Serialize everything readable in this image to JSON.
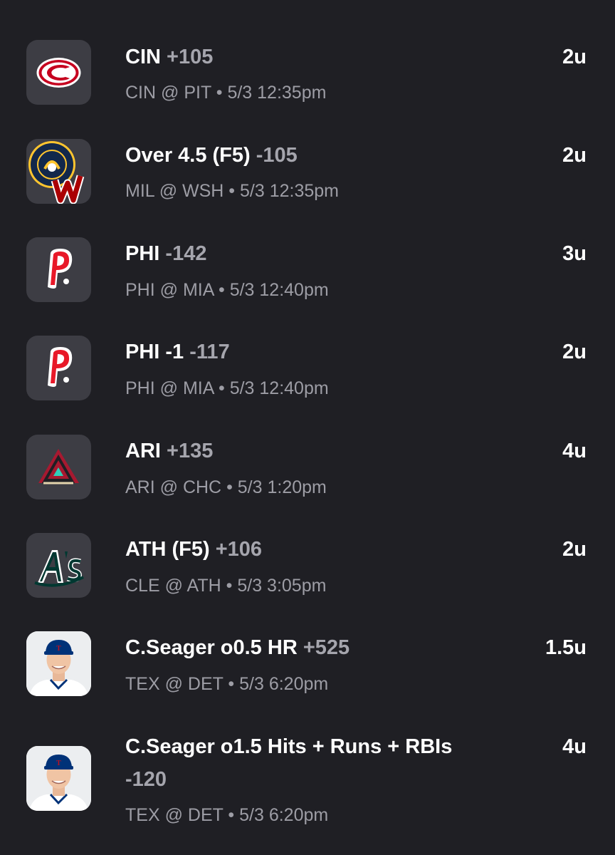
{
  "bets": [
    {
      "pick": "CIN",
      "odds": "+105",
      "units": "2u",
      "game": "CIN @ PIT",
      "dot": "•",
      "time": "5/3 12:35pm",
      "logo_icon": "reds-logo-icon",
      "accent": "#c6011f"
    },
    {
      "pick": "Over 4.5 (F5)",
      "odds": "-105",
      "units": "2u",
      "game": "MIL @ WSH",
      "dot": "•",
      "time": "5/3 12:35pm",
      "logo_icon": "brewers-nationals-logo-icon",
      "accent": "#12284b"
    },
    {
      "pick": "PHI",
      "odds": "-142",
      "units": "3u",
      "game": "PHI @ MIA",
      "dot": "•",
      "time": "5/3 12:40pm",
      "logo_icon": "phillies-logo-icon",
      "accent": "#e81828"
    },
    {
      "pick": "PHI -1",
      "odds": "-117",
      "units": "2u",
      "game": "PHI @ MIA",
      "dot": "•",
      "time": "5/3 12:40pm",
      "logo_icon": "phillies-logo-icon",
      "accent": "#e81828"
    },
    {
      "pick": "ARI",
      "odds": "+135",
      "units": "4u",
      "game": "ARI @ CHC",
      "dot": "•",
      "time": "5/3 1:20pm",
      "logo_icon": "diamondbacks-logo-icon",
      "accent": "#a71930"
    },
    {
      "pick": "ATH (F5)",
      "odds": "+106",
      "units": "2u",
      "game": "CLE @ ATH",
      "dot": "•",
      "time": "5/3 3:05pm",
      "logo_icon": "athletics-logo-icon",
      "accent": "#003831"
    },
    {
      "pick": "C.Seager o0.5 HR",
      "odds": "+525",
      "units": "1.5u",
      "game": "TEX @ DET",
      "dot": "•",
      "time": "5/3 6:20pm",
      "logo_icon": "player-headshot-icon",
      "accent": "#003278"
    },
    {
      "pick": "C.Seager o1.5 Hits + Runs + RBIs",
      "odds": "-120",
      "units": "4u",
      "game": "TEX @ DET",
      "dot": "•",
      "time": "5/3 6:20pm",
      "logo_icon": "player-headshot-icon",
      "accent": "#003278"
    }
  ]
}
